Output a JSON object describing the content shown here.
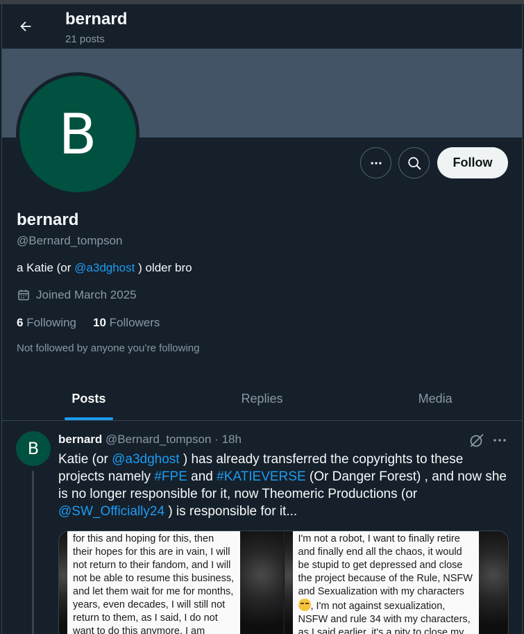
{
  "header": {
    "name": "bernard",
    "post_count": "21 posts",
    "back_icon": "arrow-left-icon"
  },
  "profile": {
    "avatar_letter": "B",
    "name": "bernard",
    "handle": "@Bernard_tompson",
    "bio_prefix": "a Katie (or ",
    "bio_mention": "@a3dghost",
    "bio_suffix": " ) older bro",
    "joined": "Joined March 2025",
    "following_count": "6",
    "following_label": "Following",
    "followers_count": "10",
    "followers_label": "Followers",
    "not_followed": "Not followed by anyone you’re following",
    "follow_label": "Follow"
  },
  "colors": {
    "background": "#15202b",
    "banner": "#425466",
    "avatar": "#00513f",
    "accent": "#1d9bf0",
    "muted": "#8b98a5"
  },
  "tabs": [
    {
      "label": "Posts",
      "active": true
    },
    {
      "label": "Replies",
      "active": false
    },
    {
      "label": "Media",
      "active": false
    }
  ],
  "post": {
    "avatar_letter": "B",
    "author": "bernard",
    "handle": "@Bernard_tompson",
    "separator": "·",
    "time": "18h",
    "text": {
      "t1": "Katie (or ",
      "m1": "@a3dghost",
      "t2": " ) has already transferred the copyrights to these projects namely ",
      "h1": "#FPE",
      "t3": " and ",
      "h2": "#KATIEVERSE",
      "t4": " (Or Danger Forest) , and now she is no longer responsible for it, now Theomeric Productions (or ",
      "m2": "@SW_Officially24",
      "t5": " ) is responsible for it..."
    },
    "media_left_text": "for this and hoping for this, then their hopes for this are in vain, I will not return to their fandom, and I will not be able to resume this business, and let them wait for me for months, years, even decades, I will still not return to them, as I said, I do not want to do this anymore, I am exhausted, and I will not be able to do this anymore, I",
    "media_right_text_a": "I'm not a robot, I want to finally retire and finally end all the chaos, it would be stupid to get depressed and close the project because of the Rule, NSFW and Sexualization with my characters ",
    "media_right_text_b": ", I'm not against sexualization, NSFW and rule 34 with my characters, as I said earlier, it's a pity to close my project, the story of Paper School is"
  }
}
